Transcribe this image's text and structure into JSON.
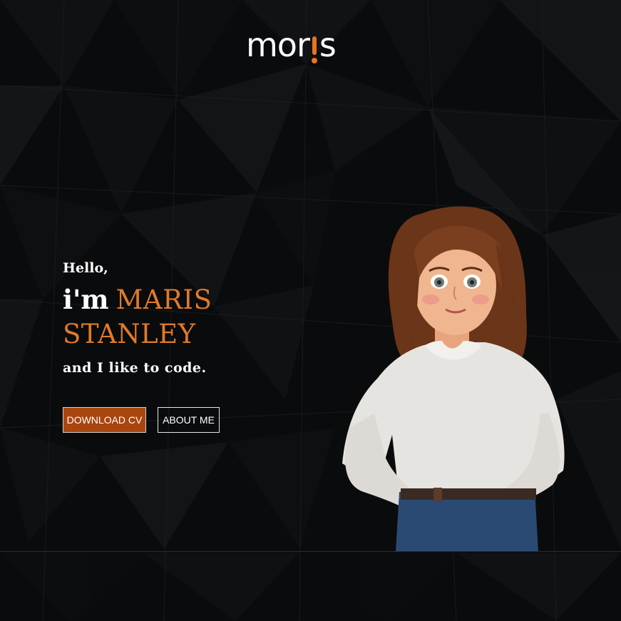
{
  "logo": {
    "text_before": "mor",
    "text_after": "s"
  },
  "hero": {
    "greeting": "Hello,",
    "im": "i'm",
    "name_first": "MARIS",
    "name_last": "STANLEY",
    "tagline": "and I like to code."
  },
  "buttons": {
    "download_cv": "DOWNLOAD CV",
    "about_me": "ABOUT ME"
  },
  "colors": {
    "accent": "#e07a2a",
    "button_fill": "#a9450f",
    "background": "#0a0b0c"
  },
  "icons": {
    "avatar": "cartoon-woman-illustration"
  }
}
